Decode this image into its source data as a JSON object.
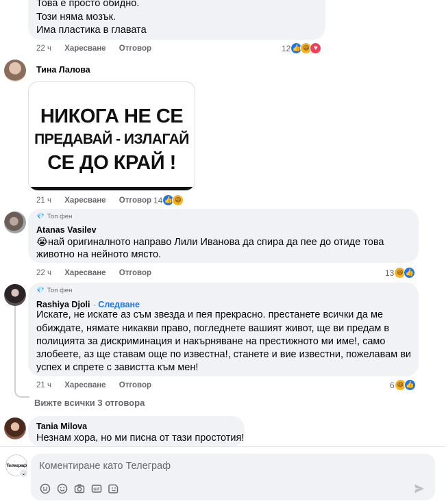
{
  "comment1": {
    "lines": [
      "Това е просто обидно.",
      "Този няма мозък.",
      "Има пластика в главата"
    ],
    "time": "22 ч",
    "like": "Харесване",
    "reply": "Отговор",
    "reactions": "12"
  },
  "comment2": {
    "author": "Тина Лалова",
    "image_lines": [
      "НИКОГА НЕ СЕ",
      "ПРЕДАВАЙ - ИЗЛАГАЙ",
      "СЕ ДО КРАЙ !"
    ],
    "time": "21 ч",
    "like": "Харесване",
    "reply": "Отговор",
    "reactions": "14"
  },
  "comment3": {
    "badge": "Топ фен",
    "author": "Atanas Vasilev",
    "emoji": "😭",
    "lines": [
      "най оригиналното направо Лили Иванова да спира да пее до отиде това",
      "животно на нейното място."
    ],
    "time": "22 ч",
    "like": "Харесване",
    "reply": "Отговор",
    "reactions": "13"
  },
  "comment4": {
    "badge": "Топ фен",
    "author": "Rashiya Djoli",
    "follow": "Следване",
    "lines": [
      "Искате, не искате аз съм звезда и пея прекрасно. престанете всички да ме",
      "обиждате, нямате никакви право, погледнете вашият живот, ще ви предам в",
      "полицията за дискриминация и накърняване на престижното ми име!, само",
      "злобеете, аз ще ставам още по известна!, станете и вие известни, пожелавам ви",
      "успех и спрете с завистта към мен!"
    ],
    "time": "21 ч",
    "like": "Харесване",
    "reply": "Отговор",
    "reactions": "6"
  },
  "view_replies": "Вижте всички 3 отговора",
  "comment5": {
    "author": "Tania Milova",
    "lines": [
      "Незнам хора, но ми писна от тази простотия!"
    ]
  },
  "composer": {
    "placeholder": "Коментиране като Телеграф",
    "page_avatar_text": "Телеграф"
  }
}
